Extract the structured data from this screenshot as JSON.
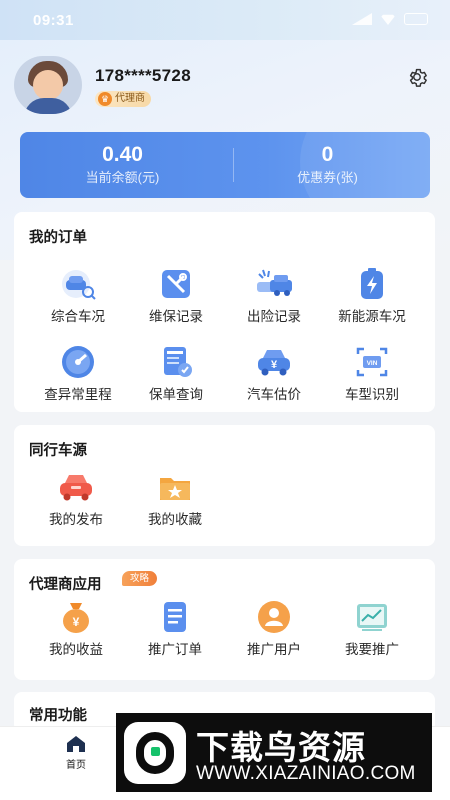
{
  "status_bar": {
    "time": "09:31"
  },
  "profile": {
    "phone": "178****5728",
    "badge": "代理商"
  },
  "balance_card": {
    "balance_value": "0.40",
    "balance_label": "当前余额(元)",
    "coupon_value": "0",
    "coupon_label": "优惠券(张)"
  },
  "my_orders": {
    "title": "我的订单",
    "items": [
      {
        "label": "综合车况",
        "icon": "car-check-icon"
      },
      {
        "label": "维保记录",
        "icon": "maintenance-tools-icon"
      },
      {
        "label": "出险记录",
        "icon": "car-accident-icon"
      },
      {
        "label": "新能源车况",
        "icon": "battery-icon"
      },
      {
        "label": "查异常里程",
        "icon": "speedometer-icon"
      },
      {
        "label": "保单查询",
        "icon": "insurance-policy-icon"
      },
      {
        "label": "汽车估价",
        "icon": "car-price-icon"
      },
      {
        "label": "车型识别",
        "icon": "vin-scan-icon"
      }
    ]
  },
  "peer_sources": {
    "title": "同行车源",
    "items": [
      {
        "label": "我的发布",
        "icon": "car-publish-icon"
      },
      {
        "label": "我的收藏",
        "icon": "folder-star-icon"
      }
    ]
  },
  "agent_apps": {
    "title": "代理商应用",
    "tag": "攻略",
    "items": [
      {
        "label": "我的收益",
        "icon": "money-bag-icon"
      },
      {
        "label": "推广订单",
        "icon": "document-list-icon"
      },
      {
        "label": "推广用户",
        "icon": "user-icon"
      },
      {
        "label": "我要推广",
        "icon": "chart-trend-icon"
      }
    ]
  },
  "common_functions": {
    "title": "常用功能"
  },
  "bottom_nav": {
    "home_label": "首页"
  },
  "watermark": {
    "title": "下载鸟资源",
    "url": "WWW.XIAZAINIAO.COM"
  },
  "colors": {
    "accent": "#4f86e6",
    "orange": "#f07f3a",
    "red": "#f05a4a"
  }
}
